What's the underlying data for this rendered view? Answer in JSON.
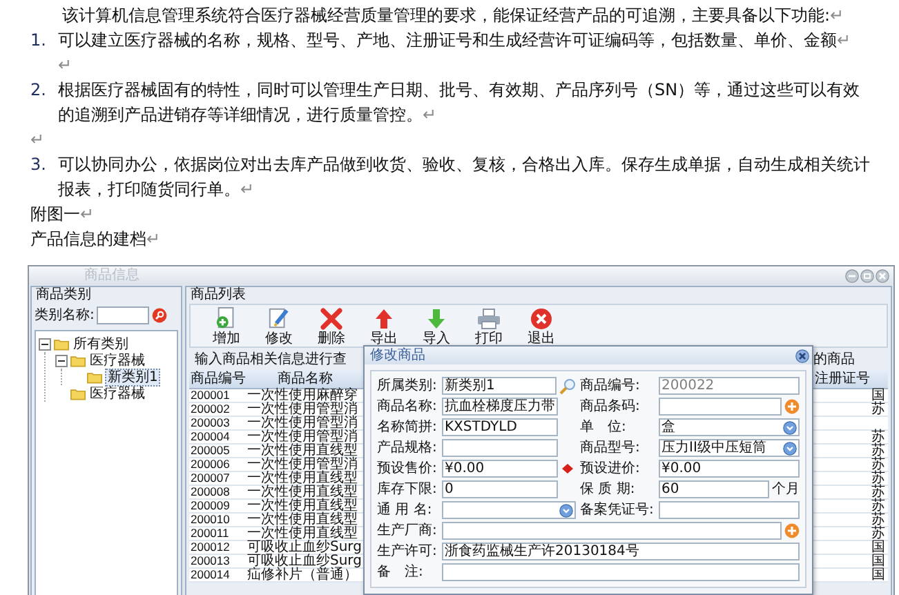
{
  "document": {
    "paragraphs": [
      {
        "kind": "body",
        "text": "该计算机信息管理系统符合医疗器械经营质量管理的要求，能保证经营产品的可追溯，主要具备以下功能:",
        "end_mark": "↵",
        "indented": true
      },
      {
        "kind": "numbered",
        "number": "1.",
        "text": "可以建立医疗器械的名称，规格、型号、产地、注册证号和生成经营许可证编码等，包括数量、单价、金额",
        "end_mark": "↵",
        "extra_line_mark": "↵"
      },
      {
        "kind": "numbered",
        "number": "2.",
        "text": "根据医疗器械固有的特性，同时可以管理生产日期、批号、有效期、产品序列号（SN）等，通过这些可以有效的追溯到产品进销存等详细情况，进行质量管控。",
        "end_mark": "↵"
      },
      {
        "kind": "empty",
        "end_mark": "↵"
      },
      {
        "kind": "numbered",
        "number": "3.",
        "text": "可以协同办公，依据岗位对出去库产品做到收货、验收、复核，合格出入库。保存生成单据，自动生成相关统计报表，打印随货同行单。",
        "end_mark": "↵"
      },
      {
        "kind": "body",
        "text": "附图一",
        "end_mark": "↵",
        "indented": false
      },
      {
        "kind": "body",
        "text": "产品信息的建档",
        "end_mark": "↵",
        "indented": false
      }
    ]
  },
  "app_window": {
    "title": "商品信息",
    "category_panel": {
      "title": "商品类别",
      "filter_label": "类别名称:",
      "tree": [
        {
          "label": "所有类别",
          "expanded": true,
          "selected": false,
          "children": [
            {
              "label": "医疗器械",
              "expanded": true,
              "selected": false,
              "children": [
                {
                  "label": "新类别1",
                  "selected": true
                }
              ]
            },
            {
              "label": "医疗器械",
              "selected": false
            }
          ]
        }
      ]
    },
    "product_panel": {
      "title": "商品列表",
      "toolbar": [
        {
          "kind": "add",
          "label": "增加"
        },
        {
          "kind": "edit",
          "label": "修改"
        },
        {
          "kind": "delete",
          "label": "删除"
        },
        {
          "kind": "export",
          "label": "导出"
        },
        {
          "kind": "import",
          "label": "导入"
        },
        {
          "kind": "print",
          "label": "打印"
        },
        {
          "kind": "exit",
          "label": "退出"
        }
      ],
      "search_hint": "输入商品相关信息进行查",
      "search_hint_end": "的商品",
      "table": {
        "columns": [
          "商品编号",
          "商品名称",
          "注册证号"
        ],
        "rows": [
          {
            "code": "200001",
            "name": "一次性使用麻醉穿",
            "column_4": "国"
          },
          {
            "code": "200002",
            "name": "一次性使用管型消",
            "column_4": "苏"
          },
          {
            "code": "200003",
            "name": "一次性使用管型消"
          },
          {
            "code": "200004",
            "name": "一次性使用管型消",
            "column_4": "苏"
          },
          {
            "code": "200005",
            "name": "一次性使用直线型",
            "column_4": "苏"
          },
          {
            "code": "200006",
            "name": "一次性使用管型消",
            "column_4": "苏"
          },
          {
            "code": "200007",
            "name": "一次性使用直线型",
            "column_4": "苏"
          },
          {
            "code": "200008",
            "name": "一次性使用直线型",
            "column_4": "苏"
          },
          {
            "code": "200009",
            "name": "一次性使用直线型",
            "column_4": "苏"
          },
          {
            "code": "200010",
            "name": "一次性使用直线型",
            "column_4": "苏"
          },
          {
            "code": "200011",
            "name": "一次性使用直线型",
            "column_4": "苏"
          },
          {
            "code": "200012",
            "name": "可吸收止血纱Surg",
            "column_4": "国"
          },
          {
            "code": "200013",
            "name": "可吸收止血纱Surg",
            "column_4": "国"
          },
          {
            "code": "200014",
            "name": "疝修补片（普通）",
            "column_4": "国"
          }
        ]
      }
    },
    "dialog": {
      "title": "修改商品",
      "rows": [
        {
          "left": {
            "label": "所属类别:",
            "value": "新类别1",
            "kind": "search"
          },
          "right": {
            "label": "商品编号:",
            "value": "200022",
            "kind": "readonly"
          }
        },
        {
          "left": {
            "label": "商品名称:",
            "value": "抗血栓梯度压力带",
            "kind": "text"
          },
          "right": {
            "label": "商品条码:",
            "kind": "add"
          }
        },
        {
          "left": {
            "label": "名称简拼:",
            "value": "KXSTDYLD",
            "kind": "text"
          },
          "right": {
            "label": "单　位:",
            "value": "盒",
            "kind": "dropdown"
          }
        },
        {
          "left": {
            "label": "产品规格:",
            "kind": "text"
          },
          "right": {
            "label": "商品型号:",
            "value": "压力II级中压短筒",
            "kind": "dropdown"
          }
        },
        {
          "left": {
            "label": "预设售价:",
            "value": "¥0.00",
            "kind": "required"
          },
          "right": {
            "label": "预设进价:",
            "value": "¥0.00",
            "kind": "text"
          }
        },
        {
          "left": {
            "label": "库存下限:",
            "value": "0",
            "kind": "text"
          },
          "right": {
            "label": "保 质 期:",
            "value": "60",
            "kind": "text",
            "suffix": "个月"
          }
        },
        {
          "left": {
            "label": "通 用 名:",
            "kind": "dropdown"
          },
          "right": {
            "label": "备案凭证号:",
            "kind": "text"
          }
        },
        {
          "wide": {
            "label": "生产厂商:",
            "kind": "add"
          }
        },
        {
          "wide": {
            "label": "生产许可:",
            "value": "浙食药监械生产许20130184号",
            "kind": "text"
          }
        },
        {
          "wide": {
            "label": "备　注:",
            "kind": "text"
          }
        }
      ]
    }
  }
}
